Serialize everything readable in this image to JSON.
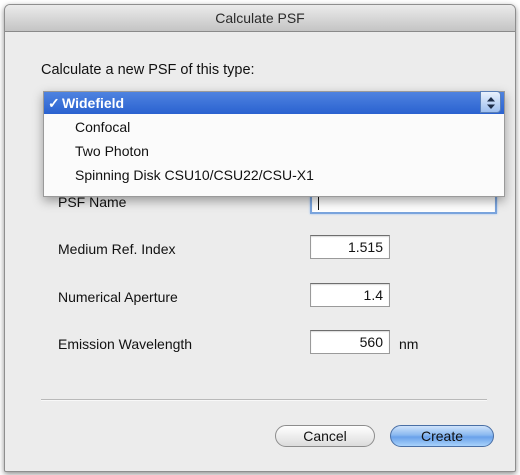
{
  "window": {
    "title": "Calculate PSF"
  },
  "prompt": "Calculate a new PSF of this type:",
  "psf_type_menu": {
    "options": [
      {
        "check": "✓",
        "label": "Widefield",
        "selected": true
      },
      {
        "check": "",
        "label": "Confocal",
        "selected": false
      },
      {
        "check": "",
        "label": "Two Photon",
        "selected": false
      },
      {
        "check": "",
        "label": "Spinning Disk CSU10/CSU22/CSU-X1",
        "selected": false
      }
    ],
    "arrows_icon": "up-down-arrows-icon"
  },
  "fields": {
    "psf_name": {
      "label": "PSF Name",
      "value": ""
    },
    "medium_ref_index": {
      "label": "Medium Ref. Index",
      "value": "1.515"
    },
    "numerical_aperture": {
      "label": "Numerical Aperture",
      "value": "1.4"
    },
    "emission_wavelength": {
      "label": "Emission Wavelength",
      "value": "560",
      "unit": "nm"
    }
  },
  "buttons": {
    "cancel": "Cancel",
    "create": "Create"
  },
  "colors": {
    "selection": "#2a62d0",
    "default_button": "#6aa1ea",
    "focus_ring": "#7aa4dd"
  }
}
